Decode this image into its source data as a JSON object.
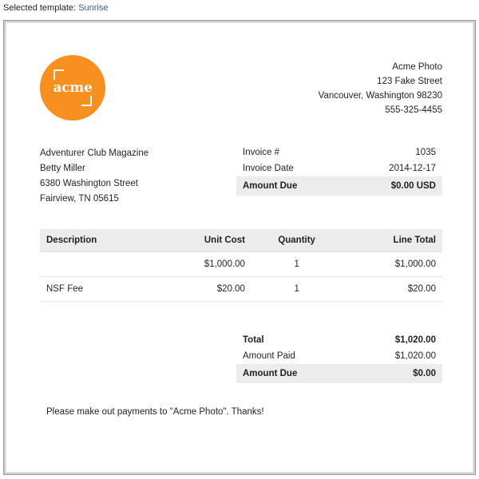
{
  "template_bar": {
    "label": "Selected template:",
    "template_name": "Sunrise",
    "link_color": "#3c5a96"
  },
  "invoice": {
    "logo": {
      "text": "acme",
      "color": "#f7901e",
      "bracket_color": "#ffffff"
    },
    "company": {
      "name": "Acme Photo",
      "street": "123 Fake Street",
      "city_state_zip": "Vancouver, Washington 98230",
      "phone": "555-325-4455"
    },
    "bill_to": {
      "line1": "Adventurer Club Magazine",
      "line2": "Betty Miller",
      "line3": "6380 Washington Street",
      "line4": "Fairview, TN 05615"
    },
    "meta": {
      "invoice_number_label": "Invoice #",
      "invoice_number_value": "1035",
      "invoice_date_label": "Invoice Date",
      "invoice_date_value": "2014-12-17",
      "amount_due_label": "Amount Due",
      "amount_due_value": "$0.00 USD"
    },
    "items": {
      "headers": {
        "description": "Description",
        "unit_cost": "Unit Cost",
        "quantity": "Quantity",
        "line_total": "Line Total"
      },
      "rows": [
        {
          "description": "",
          "unit_cost": "$1,000.00",
          "quantity": "1",
          "line_total": "$1,000.00"
        },
        {
          "description": "NSF Fee",
          "unit_cost": "$20.00",
          "quantity": "1",
          "line_total": "$20.00"
        }
      ]
    },
    "totals": {
      "total_label": "Total",
      "total_value": "$1,020.00",
      "amount_paid_label": "Amount Paid",
      "amount_paid_value": "$1,020.00",
      "amount_due_label": "Amount Due",
      "amount_due_value": "$0.00"
    },
    "footer_note": "Please make out payments to \"Acme Photo\". Thanks!"
  }
}
